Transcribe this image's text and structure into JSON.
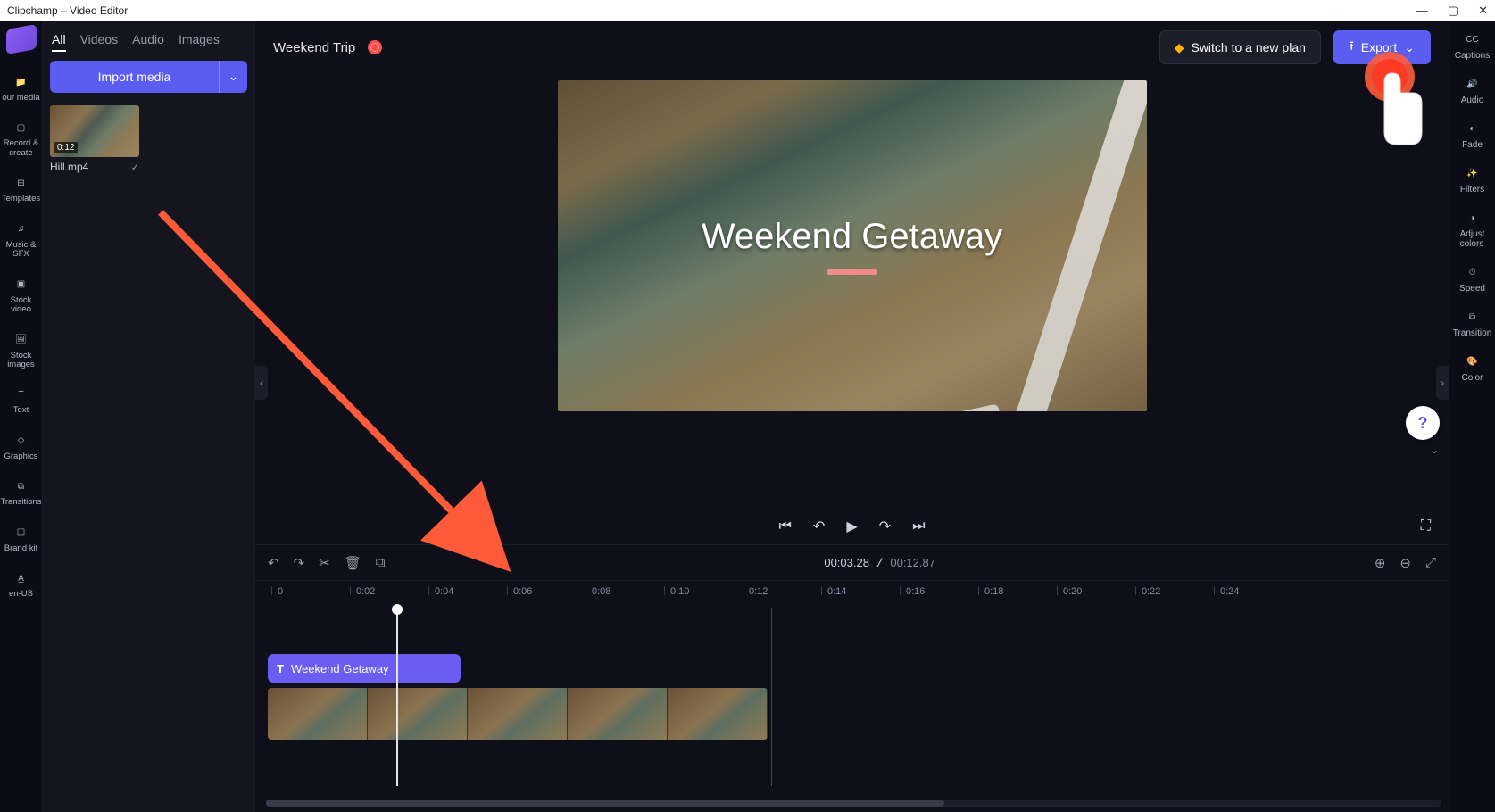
{
  "window": {
    "title": "Clipchamp – Video Editor"
  },
  "leftrail": {
    "items": [
      {
        "label": "our media"
      },
      {
        "label": "Record &\ncreate"
      },
      {
        "label": "Templates"
      },
      {
        "label": "Music & SFX"
      },
      {
        "label": "Stock video"
      },
      {
        "label": "Stock\nimages"
      },
      {
        "label": "Text"
      },
      {
        "label": "Graphics"
      },
      {
        "label": "Transitions"
      },
      {
        "label": "Brand kit"
      },
      {
        "label": "en-US"
      }
    ]
  },
  "media": {
    "tabs": [
      "All",
      "Videos",
      "Audio",
      "Images"
    ],
    "active_tab": 0,
    "import_label": "Import media",
    "clip": {
      "duration": "0:12",
      "name": "Hill.mp4"
    }
  },
  "topbar": {
    "project_name": "Weekend Trip",
    "plan_label": "Switch to a new plan",
    "export_label": "Export"
  },
  "preview": {
    "overlay_text": "Weekend Getaway"
  },
  "transport": {
    "time_current": "00:03.28",
    "time_total": "00:12.87"
  },
  "timeline": {
    "ruler": [
      "0",
      "0:02",
      "0:04",
      "0:06",
      "0:08",
      "0:10",
      "0:12",
      "0:14",
      "0:16",
      "0:18",
      "0:20",
      "0:22",
      "0:24"
    ],
    "text_clip_label": "Weekend Getaway"
  },
  "rightrail": {
    "items": [
      {
        "label": "Captions"
      },
      {
        "label": "Audio"
      },
      {
        "label": "Fade"
      },
      {
        "label": "Filters"
      },
      {
        "label": "Adjust\ncolors"
      },
      {
        "label": "Speed"
      },
      {
        "label": "Transition"
      },
      {
        "label": "Color"
      }
    ]
  }
}
